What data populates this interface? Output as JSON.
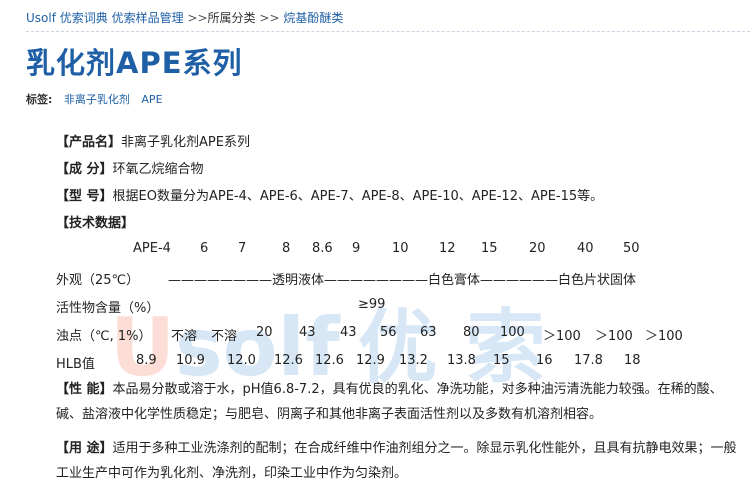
{
  "breadcrumb": {
    "home": "Usolf 优索词典",
    "section": "优索样品管理",
    "arrow1": ">>",
    "category": "所属分类",
    "arrow2": ">>",
    "current": "烷基酚醚类"
  },
  "page_title": "乳化剂APE系列",
  "tags": {
    "label": "标签:",
    "items": [
      "非离子乳化剂",
      "APE"
    ]
  },
  "watermark": {
    "part1": "U",
    "part2": "solf",
    "part3": "优 索"
  },
  "product_name": {
    "label": "【产品名】",
    "value": "非离子乳化剂APE系列"
  },
  "composition": {
    "label": "【成 分】",
    "value": "环氧乙烷缩合物"
  },
  "model": {
    "label": "【型 号】",
    "value": "根据EO数量分为APE-4、APE-6、APE-7、APE-8、APE-10、APE-12、APE-15等。"
  },
  "tech_data": {
    "label": "【技术数据】",
    "header": [
      "APE-4",
      "6",
      "7",
      "8",
      "8.6",
      "9",
      "10",
      "12",
      "15",
      "20",
      "40",
      "50"
    ],
    "appearance": {
      "label": "外观（25℃）",
      "dash1": "————————",
      "v1": "透明液体",
      "dash2": "————————",
      "v2": "白色膏体",
      "dash3": "——————",
      "v3": "白色片状固体"
    },
    "active": {
      "label": "活性物含量（%）",
      "value": "≥99"
    },
    "cloud_point": {
      "label": "浊点（℃, 1%）",
      "values": [
        "不溶",
        "不溶",
        "20",
        "43",
        "43",
        "56",
        "63",
        "80",
        "100",
        "＞100",
        "＞100",
        "＞100"
      ]
    },
    "hlb": {
      "label": "HLB值",
      "values": [
        "8.9",
        "10.9",
        "12.0",
        "12.6",
        "12.6",
        "12.9",
        "13.2",
        "13.8",
        "15",
        "16",
        "17.8",
        "18"
      ]
    }
  },
  "performance": {
    "label": "【性 能】",
    "value": "本品易分散或溶于水，pH值6.8-7.2，具有优良的乳化、净洗功能，对多种油污清洗能力较强。在稀的酸、碱、盐溶液中化学性质稳定；与肥皂、阴离子和其他非离子表面活性剂以及多数有机溶剂相容。"
  },
  "usage": {
    "label": "【用 途】",
    "value": "适用于多种工业洗涤剂的配制；在合成纤维中作油剂组分之一。除显示乳化性能外，且具有抗静电效果；一般工业生产中可作为乳化剂、净洗剂，印染工业中作为匀染剂。"
  }
}
